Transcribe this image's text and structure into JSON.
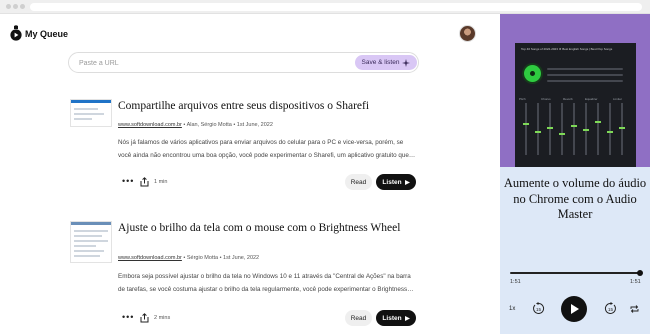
{
  "header": {
    "brand": "My Queue"
  },
  "url_bar": {
    "placeholder": "Paste a URL",
    "save_label": "Save & listen"
  },
  "articles": [
    {
      "title": "Compartilhe arquivos entre seus dispositivos o Sharefi",
      "source": "www.softdownload.com.br",
      "byline": " • Alan, Sérgio Motta • 1st June, 2022",
      "excerpt": "Nós já falamos de vários aplicativos para enviar arquivos do celular para o PC e vice-versa, porém, se você ainda não encontrou uma boa opção, você pode experimentar o Sharefi, um aplicativo gratuito que…",
      "duration": "1 min",
      "read_label": "Read",
      "listen_label": "Listen"
    },
    {
      "title": "Ajuste o brilho da tela com o mouse com o Brightness Wheel",
      "source": "www.softdownload.com.br",
      "byline": " • Sérgio Motta • 1st June, 2022",
      "excerpt": "Embora seja possível ajustar o brilho da tela no Windows 10 e 11 através da \"Central de Ações\" na barra de tarefas, se você costuma ajustar o brilho da tela regularmente, você pode experimentar o Brightness…",
      "duration": "2 mins",
      "read_label": "Read",
      "listen_label": "Listen"
    }
  ],
  "player": {
    "art_heading": "Top 40 Songs of 2022-2023 ★ Best English Songs | Best Pop Songs",
    "eq_labels": [
      "Pitch",
      "Chorus",
      "Reverb",
      "Equalizer",
      "Limiter"
    ],
    "title": "Aumente o volume do áudio no Chrome com o Audio Master",
    "progress": 1.0,
    "time_elapsed": "1:51",
    "time_total": "1:51",
    "speed": "1x",
    "skip_back": "15",
    "skip_forward": "15"
  },
  "colors": {
    "accent_soft": "#d9c7f5",
    "art_background": "#8f6fc4",
    "panel_background": "#dde8f7",
    "eq_green": "#2ecc40"
  }
}
